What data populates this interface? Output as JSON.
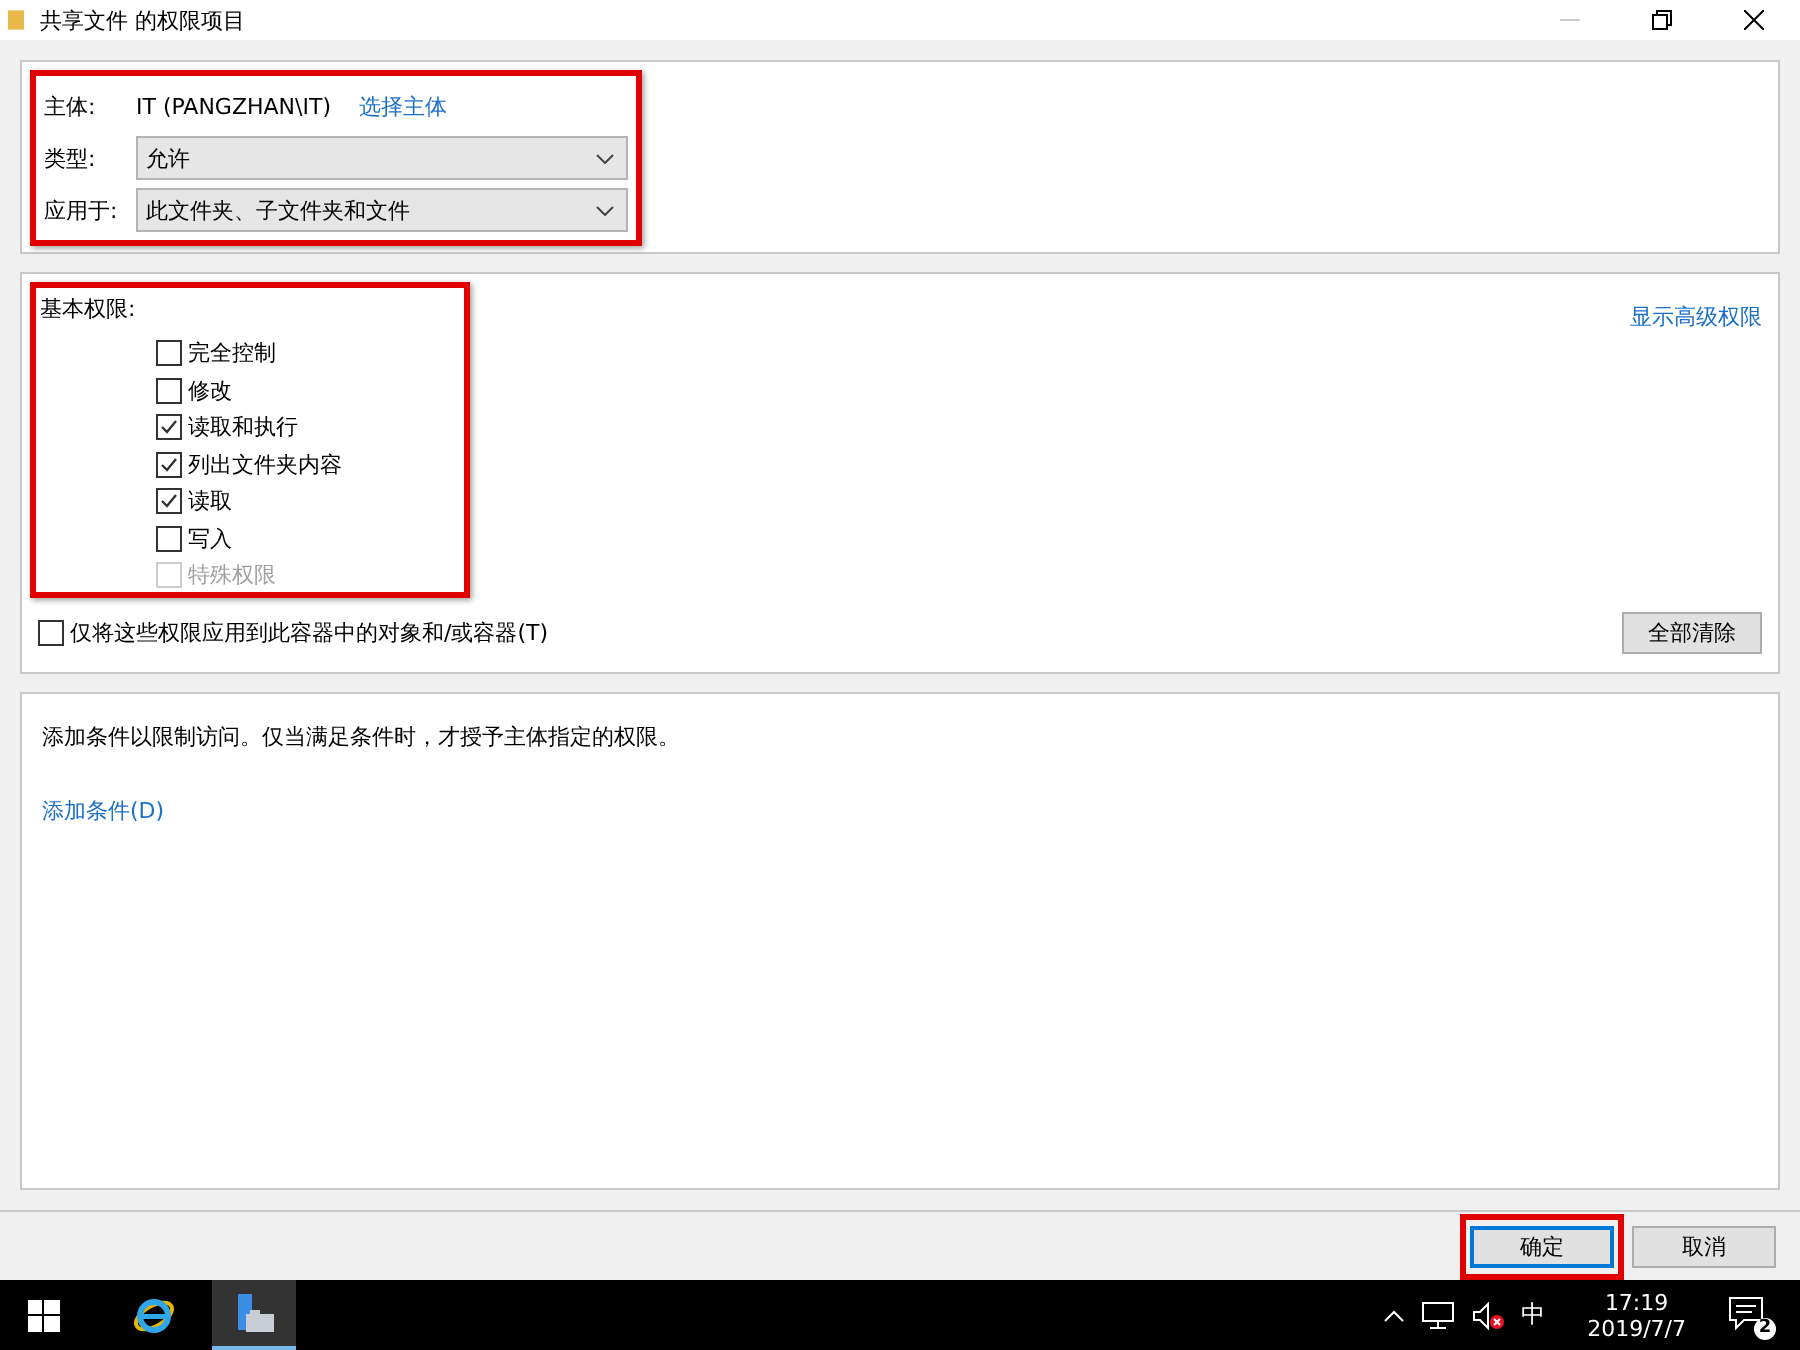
{
  "window": {
    "title": "共享文件 的权限项目"
  },
  "principal_section": {
    "highlighted": true,
    "principal": {
      "label": "主体:",
      "value": "IT (PANGZHAN\\IT)",
      "link": "选择主体"
    },
    "type_field": {
      "label": "类型:",
      "value": "允许"
    },
    "applies_to": {
      "label": "应用于:",
      "value": "此文件夹、子文件夹和文件"
    }
  },
  "permissions_section": {
    "highlighted": true,
    "label": "基本权限:",
    "advanced_link": "显示高级权限",
    "items": [
      {
        "label": "完全控制",
        "checked": false,
        "disabled": false
      },
      {
        "label": "修改",
        "checked": false,
        "disabled": false
      },
      {
        "label": "读取和执行",
        "checked": true,
        "disabled": false
      },
      {
        "label": "列出文件夹内容",
        "checked": true,
        "disabled": false
      },
      {
        "label": "读取",
        "checked": true,
        "disabled": false
      },
      {
        "label": "写入",
        "checked": false,
        "disabled": false
      },
      {
        "label": "特殊权限",
        "checked": false,
        "disabled": true
      }
    ]
  },
  "apply_only": {
    "label": "仅将这些权限应用到此容器中的对象和/或容器(T)",
    "checked": false
  },
  "clear_all_button": "全部清除",
  "conditions": {
    "text": "添加条件以限制访问。仅当满足条件时，才授予主体指定的权限。",
    "link": "添加条件(D)"
  },
  "buttons": [
    {
      "label": "确定",
      "default": true,
      "highlighted": true
    },
    {
      "label": "取消",
      "default": false,
      "highlighted": false
    }
  ],
  "taskbar": {
    "ime": "中",
    "time": "17:19",
    "date": "2019/7/7",
    "notification_count": "2"
  }
}
